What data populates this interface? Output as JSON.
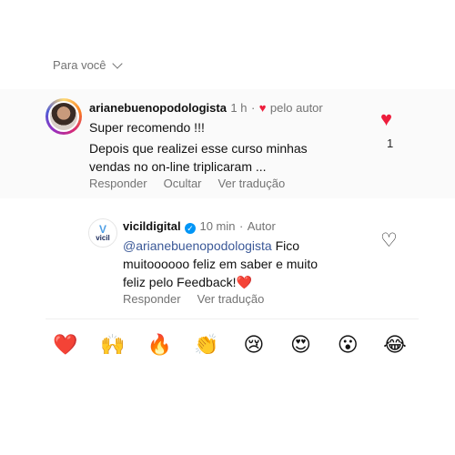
{
  "sort": {
    "label": "Para você"
  },
  "comment": {
    "username": "arianebuenopodologista",
    "time": "1 h",
    "author_tag": "pelo autor",
    "line1": "Super recomendo !!!",
    "line2": "Depois que realizei esse curso minhas",
    "line3": "vendas no on-line triplicaram ...",
    "like_count": "1",
    "actions": {
      "reply": "Responder",
      "hide": "Ocultar",
      "translate": "Ver tradução"
    }
  },
  "reply": {
    "username": "vicildigital",
    "time": "10 min",
    "badge": "Autor",
    "mention": "@arianebuenopodologista",
    "text1": " Fico",
    "line2": "muitoooooo feliz em saber e muito",
    "line3": "feliz pelo Feedback!❤️",
    "avatar_label": "vicil",
    "actions": {
      "reply": "Responder",
      "translate": "Ver tradução"
    }
  },
  "emoji_bar": [
    "❤️",
    "🙌",
    "🔥",
    "👏",
    "😢",
    "😍",
    "😮",
    "😂"
  ],
  "colors": {
    "like": "#ed1d3c",
    "muted": "#737373",
    "verified": "#0095f6"
  }
}
